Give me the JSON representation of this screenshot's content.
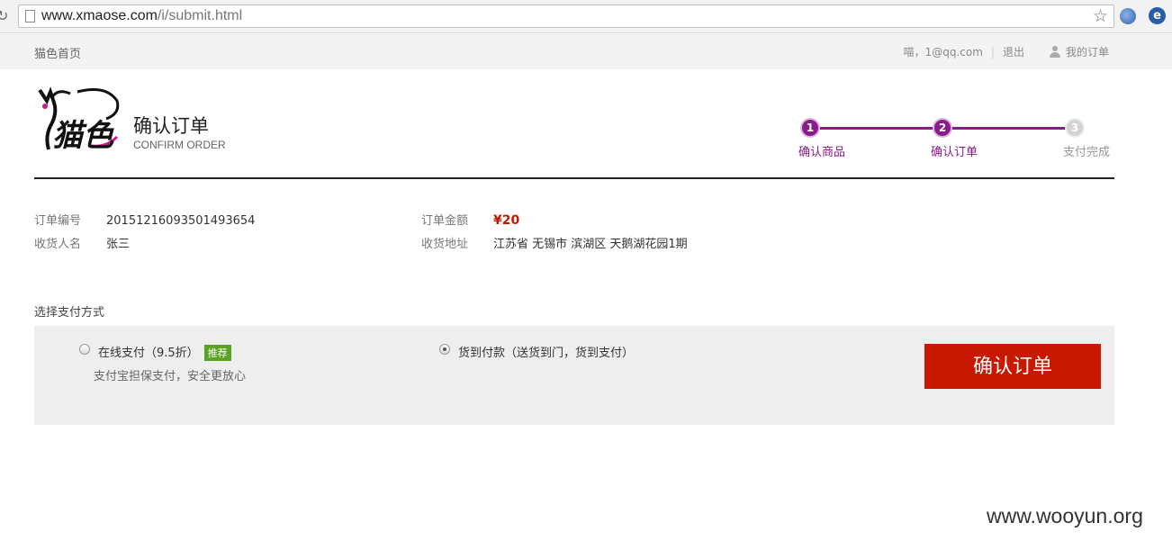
{
  "browser": {
    "url_host": "www.xmaose.com",
    "url_path": "/i/submit.html"
  },
  "topbar": {
    "home_link": "猫色首页",
    "user": "喵，1@qq.com",
    "logout": "退出",
    "my_orders": "我的订单"
  },
  "header": {
    "logo_text": "猫色",
    "title_cn": "确认订单",
    "title_en": "CONFIRM ORDER"
  },
  "steps": [
    {
      "num": "1",
      "label": "确认商品",
      "state": "done"
    },
    {
      "num": "2",
      "label": "确认订单",
      "state": "current"
    },
    {
      "num": "3",
      "label": "支付完成",
      "state": "todo"
    }
  ],
  "order": {
    "order_no_label": "订单编号",
    "order_no": "20151216093501493654",
    "amount_label": "订单金额",
    "amount": "¥20",
    "receiver_label": "收货人名",
    "receiver": "张三",
    "address_label": "收货地址",
    "address": "江苏省 无锡市 滨湖区 天鹅湖花园1期"
  },
  "payment": {
    "title": "选择支付方式",
    "online_label": "在线支付（9.5折）",
    "online_badge": "推荐",
    "online_desc": "支付宝担保支付，安全更放心",
    "cod_label": "货到付款（送货到门，货到支付）",
    "selected": "cod",
    "confirm_button": "确认订单"
  },
  "watermark": "www.wooyun.org",
  "colors": {
    "accent": "#8b1b8a",
    "price": "#c01b00",
    "button": "#c81800",
    "badge": "#5aa221"
  }
}
